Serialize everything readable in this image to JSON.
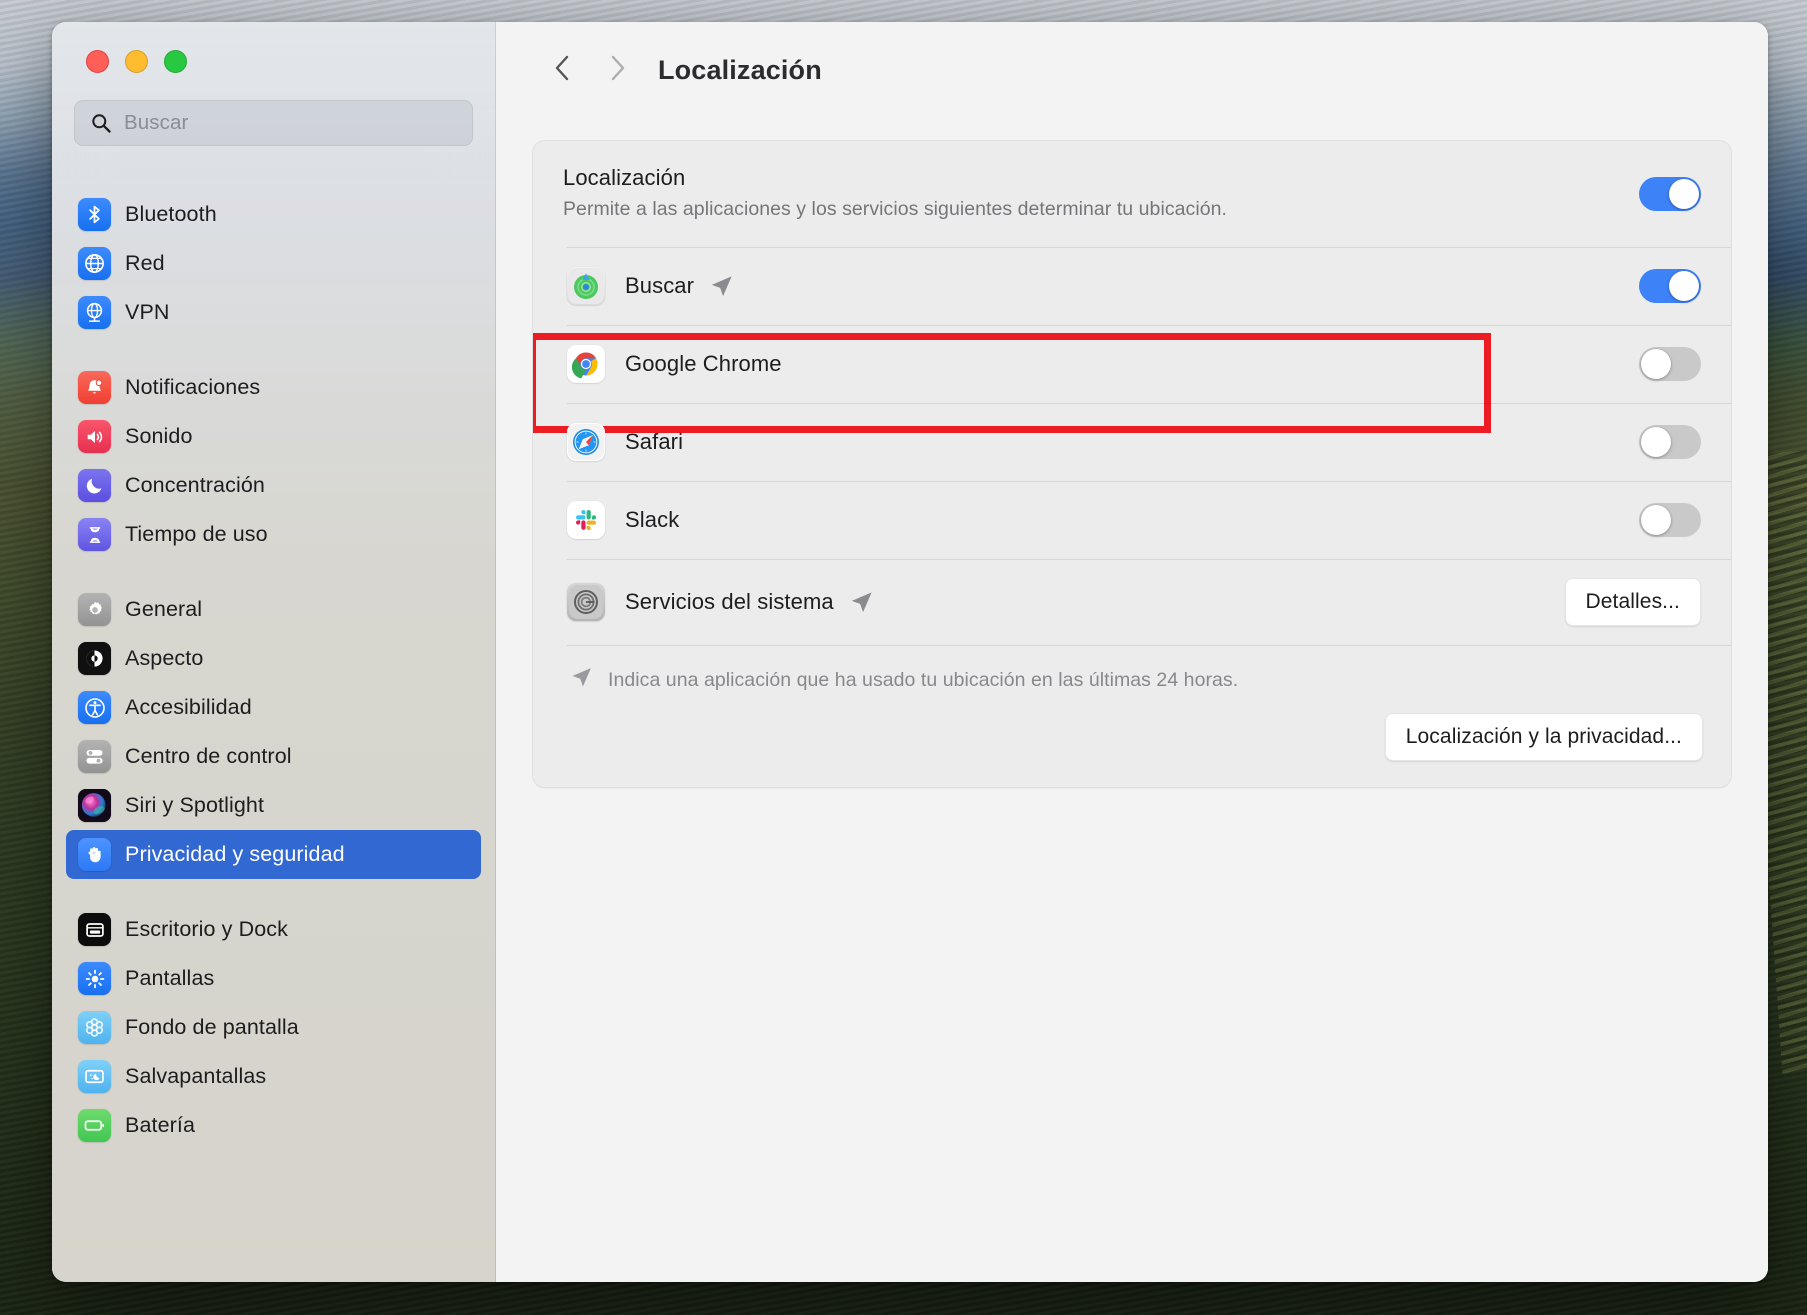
{
  "window": {
    "traffic_lights": [
      "close",
      "minimize",
      "zoom"
    ]
  },
  "search": {
    "placeholder": "Buscar",
    "value": "",
    "icon": "search-icon"
  },
  "sidebar": {
    "groups": [
      {
        "items": [
          {
            "label": "Bluetooth",
            "icon": "bluetooth-icon",
            "selected": false
          },
          {
            "label": "Red",
            "icon": "network-globe-icon",
            "selected": false
          },
          {
            "label": "VPN",
            "icon": "vpn-globe-icon",
            "selected": false
          }
        ]
      },
      {
        "items": [
          {
            "label": "Notificaciones",
            "icon": "bell-icon",
            "selected": false
          },
          {
            "label": "Sonido",
            "icon": "speaker-icon",
            "selected": false
          },
          {
            "label": "Concentración",
            "icon": "moon-icon",
            "selected": false
          },
          {
            "label": "Tiempo de uso",
            "icon": "hourglass-icon",
            "selected": false
          }
        ]
      },
      {
        "items": [
          {
            "label": "General",
            "icon": "gear-icon",
            "selected": false
          },
          {
            "label": "Aspecto",
            "icon": "appearance-icon",
            "selected": false
          },
          {
            "label": "Accesibilidad",
            "icon": "accessibility-icon",
            "selected": false
          },
          {
            "label": "Centro de control",
            "icon": "control-center-icon",
            "selected": false
          },
          {
            "label": "Siri y Spotlight",
            "icon": "siri-icon",
            "selected": false
          },
          {
            "label": "Privacidad y seguridad",
            "icon": "hand-icon",
            "selected": true
          }
        ]
      },
      {
        "items": [
          {
            "label": "Escritorio y Dock",
            "icon": "desktop-dock-icon",
            "selected": false
          },
          {
            "label": "Pantallas",
            "icon": "displays-icon",
            "selected": false
          },
          {
            "label": "Fondo de pantalla",
            "icon": "wallpaper-icon",
            "selected": false
          },
          {
            "label": "Salvapantallas",
            "icon": "screensaver-icon",
            "selected": false
          },
          {
            "label": "Batería",
            "icon": "battery-icon",
            "selected": false
          }
        ]
      }
    ],
    "selected_accent": "#3268d2"
  },
  "toolbar": {
    "back_icon": "chevron-left-icon",
    "forward_icon": "chevron-right-icon",
    "title": "Localización"
  },
  "location_panel": {
    "heading": "Localización",
    "description": "Permite a las aplicaciones y los servicios siguientes determinar tu ubicación.",
    "master_toggle": {
      "state": "on",
      "label": "Localización"
    },
    "apps": [
      {
        "name": "Buscar",
        "icon": "find-my-icon",
        "toggle": "on",
        "recently_used": true
      },
      {
        "name": "Google Chrome",
        "icon": "chrome-icon",
        "toggle": "off",
        "recently_used": false
      },
      {
        "name": "Safari",
        "icon": "safari-icon",
        "toggle": "off",
        "recently_used": false
      },
      {
        "name": "Slack",
        "icon": "slack-icon",
        "toggle": "off",
        "recently_used": false
      }
    ],
    "system_services": {
      "name": "Servicios del sistema",
      "icon": "system-services-icon",
      "recently_used": true,
      "details_button": "Detalles..."
    },
    "footnote": "Indica una aplicación que ha usado tu ubicación en las últimas 24 horas.",
    "footnote_icon": "location-arrow-icon",
    "privacy_button": "Localización y la privacidad..."
  },
  "annotations": {
    "color": "#ec1c24",
    "boxes": [
      "master-toggle",
      "buscar-row",
      "buscar-toggle"
    ]
  },
  "colors": {
    "toggle_on": "#3e82f7",
    "toggle_off": "#c9c9c9",
    "sidebar_selected": "#3268d2",
    "annotation_red": "#ec1c24"
  }
}
